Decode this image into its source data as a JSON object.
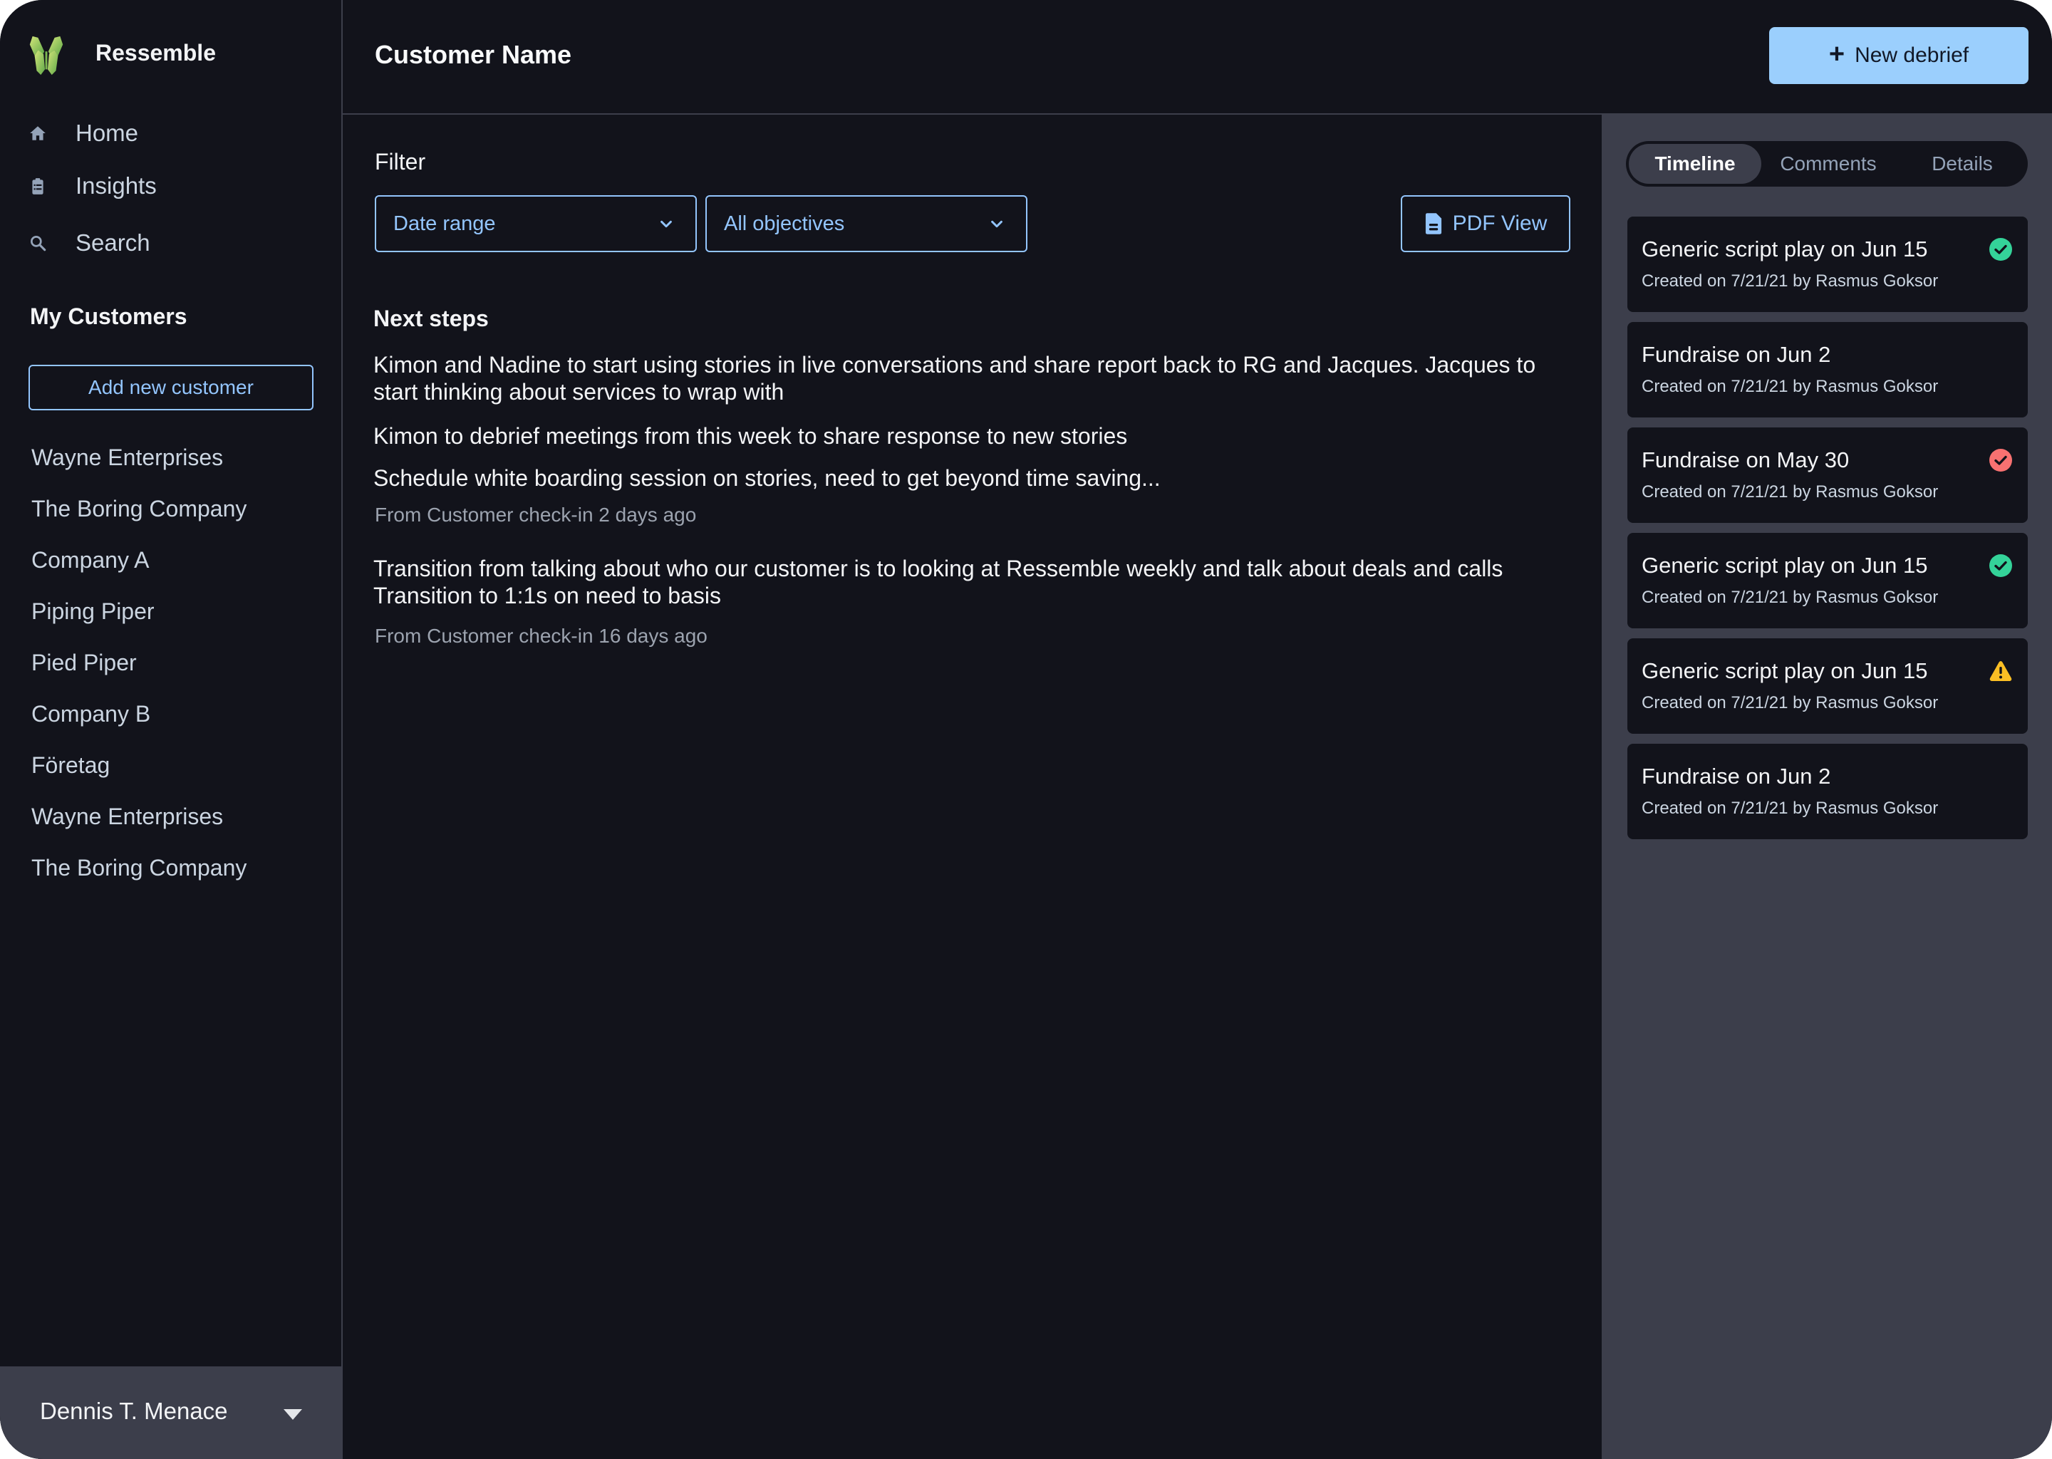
{
  "app": {
    "brand": "Ressemble"
  },
  "sidebar": {
    "nav": [
      {
        "label": "Home",
        "icon": "home-icon"
      },
      {
        "label": "Insights",
        "icon": "clipboard-icon"
      },
      {
        "label": "Search",
        "icon": "search-icon"
      }
    ],
    "section_title": "My Customers",
    "add_customer_label": "Add new customer",
    "customers": [
      "Wayne Enterprises",
      "The Boring Company",
      "Company A",
      "Piping Piper",
      "Pied Piper",
      "Company B",
      "Företag",
      "Wayne Enterprises",
      "The Boring Company"
    ],
    "user": {
      "name": "Dennis T. Menace"
    }
  },
  "header": {
    "title": "Customer Name",
    "new_debrief_label": "New debrief",
    "new_debrief_icon": "plus-icon"
  },
  "main": {
    "filter_label": "Filter",
    "filters": {
      "date_range": "Date range",
      "objectives": "All objectives"
    },
    "pdf_view_label": "PDF View",
    "next_steps_title": "Next steps",
    "groups": [
      {
        "steps": [
          "Kimon and Nadine to start using stories in live conversations and share report back to RG and Jacques. Jacques to start thinking about services to wrap with",
          "Kimon to debrief meetings from this week to share response to new stories",
          "Schedule white boarding session on stories, need to get beyond time saving..."
        ],
        "source": "From Customer check-in 2 days ago"
      },
      {
        "steps": [
          "Transition from talking about who our customer is to looking at Ressemble weekly and talk about deals and calls Transition to 1:1s on need to basis"
        ],
        "source": "From Customer check-in 16 days ago"
      }
    ]
  },
  "right_panel": {
    "tabs": [
      {
        "label": "Timeline",
        "active": true
      },
      {
        "label": "Comments",
        "active": false
      },
      {
        "label": "Details",
        "active": false
      }
    ],
    "timeline": [
      {
        "title": "Generic script play on Jun 15",
        "subtitle": "Created on 7/21/21 by Rasmus Goksor",
        "status": "success"
      },
      {
        "title": "Fundraise on Jun 2",
        "subtitle": "Created on 7/21/21 by Rasmus Goksor",
        "status": "none"
      },
      {
        "title": "Fundraise on May 30",
        "subtitle": "Created on 7/21/21 by Rasmus Goksor",
        "status": "failed"
      },
      {
        "title": "Generic script play on Jun 15",
        "subtitle": "Created on 7/21/21 by Rasmus Goksor",
        "status": "success"
      },
      {
        "title": "Generic script play on Jun 15",
        "subtitle": "Created on 7/21/21 by Rasmus Goksor",
        "status": "warning"
      },
      {
        "title": "Fundraise on Jun 2",
        "subtitle": "Created on 7/21/21 by Rasmus Goksor",
        "status": "none"
      }
    ]
  },
  "colors": {
    "background": "#12131b",
    "panel": "#3c3e4b",
    "accent": "#93c5fd",
    "primary_button": "#9bcffd",
    "success": "#34d399",
    "failed": "#f87171",
    "warning": "#fbbf24",
    "logo_green_light": "#d4e67a",
    "logo_green_dark": "#5fa848"
  }
}
